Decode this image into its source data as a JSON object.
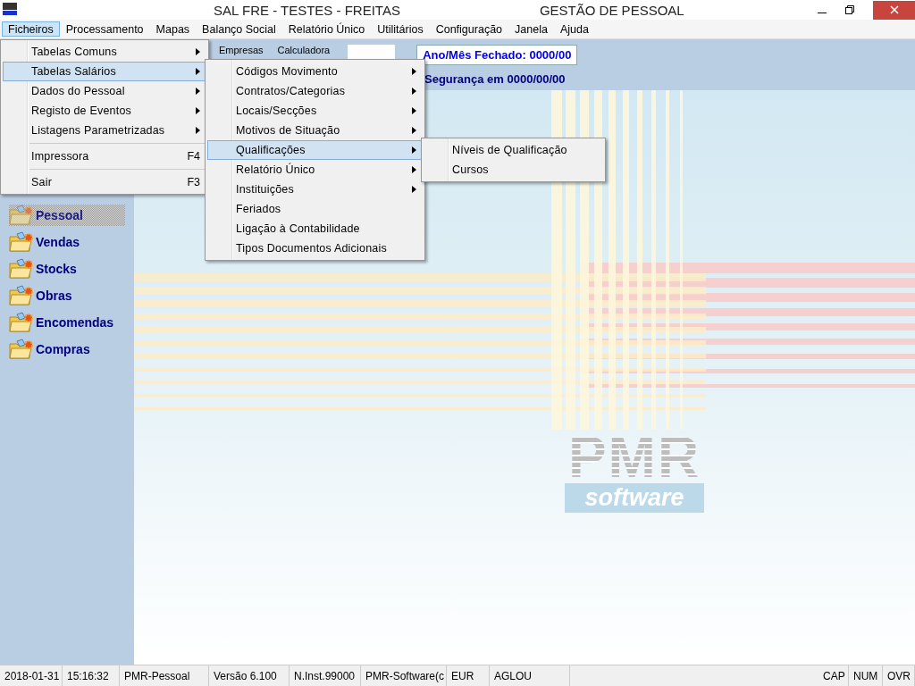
{
  "window": {
    "title": "SAL FRE - TESTES - FREITAS",
    "module": "GESTÃO DE PESSOAL"
  },
  "menubar": [
    {
      "label": "Ficheiros",
      "selected": true
    },
    {
      "label": "Processamento",
      "selected": false
    },
    {
      "label": "Mapas",
      "selected": false
    },
    {
      "label": "Balanço Social",
      "selected": false
    },
    {
      "label": "Relatório Único",
      "selected": false
    },
    {
      "label": "Utilitários",
      "selected": false
    },
    {
      "label": "Configuração",
      "selected": false
    },
    {
      "label": "Janela",
      "selected": false
    },
    {
      "label": "Ajuda",
      "selected": false
    }
  ],
  "menus": [
    {
      "items": [
        {
          "kind": "item",
          "label": "Tabelas  Comuns",
          "submenu": true,
          "selected": false
        },
        {
          "kind": "item",
          "label": "Tabelas Salários",
          "submenu": true,
          "selected": true
        },
        {
          "kind": "item",
          "label": "Dados do  Pessoal",
          "submenu": true,
          "selected": false
        },
        {
          "kind": "item",
          "label": "Registo de Eventos",
          "submenu": true,
          "selected": false
        },
        {
          "kind": "item",
          "label": "Listagens Parametrizadas",
          "submenu": true,
          "selected": false
        },
        {
          "kind": "separator"
        },
        {
          "kind": "item",
          "label": "Impressora",
          "shortcut": "F4",
          "submenu": false,
          "selected": false
        },
        {
          "kind": "separator"
        },
        {
          "kind": "item",
          "label": "Sair",
          "shortcut": "F3",
          "submenu": false,
          "selected": false
        }
      ]
    },
    {
      "items": [
        {
          "kind": "item",
          "label": "Códigos  Movimento",
          "submenu": true,
          "selected": false
        },
        {
          "kind": "item",
          "label": "Contratos/Categorias",
          "submenu": true,
          "selected": false
        },
        {
          "kind": "item",
          "label": "Locais/Secções",
          "submenu": true,
          "selected": false
        },
        {
          "kind": "item",
          "label": "Motivos de Situação",
          "submenu": true,
          "selected": false
        },
        {
          "kind": "item",
          "label": "Qualificações",
          "submenu": true,
          "selected": true
        },
        {
          "kind": "item",
          "label": "Relatório Único",
          "submenu": true,
          "selected": false
        },
        {
          "kind": "item",
          "label": "Instituições",
          "submenu": true,
          "selected": false
        },
        {
          "kind": "item",
          "label": "Feriados",
          "submenu": false,
          "selected": false
        },
        {
          "kind": "item",
          "label": "Ligação à Contabilidade",
          "submenu": false,
          "selected": false
        },
        {
          "kind": "item",
          "label": "Tipos Documentos Adicionais",
          "submenu": false,
          "selected": false
        }
      ]
    },
    {
      "items": [
        {
          "kind": "item",
          "label": "Níveis de Qualificação",
          "submenu": false,
          "selected": false
        },
        {
          "kind": "item",
          "label": "Cursos",
          "submenu": false,
          "selected": false
        }
      ]
    }
  ],
  "toolbar": {
    "buttons": [
      "Empresas",
      "Calculadora"
    ],
    "closed_period": "Ano/Mês Fechado: 0000/00",
    "security": "Segurança em  0000/00/00"
  },
  "sidebar": {
    "items": [
      {
        "label": "Pessoal",
        "selected": true
      },
      {
        "label": "Vendas",
        "selected": false
      },
      {
        "label": "Stocks",
        "selected": false
      },
      {
        "label": "Obras",
        "selected": false
      },
      {
        "label": "Encomendas",
        "selected": false
      },
      {
        "label": "Compras",
        "selected": false
      }
    ]
  },
  "logo": {
    "mark": "PMR",
    "subtitle": "software"
  },
  "status_bar": {
    "left": [
      "2018-01-31",
      "15:16:32",
      "PMR-Pessoal",
      "Versão  6.100",
      "N.Inst.99000",
      "PMR-Software(c",
      "EUR",
      "AGLOU"
    ],
    "right": [
      "CAP",
      "NUM",
      "OVR"
    ]
  }
}
